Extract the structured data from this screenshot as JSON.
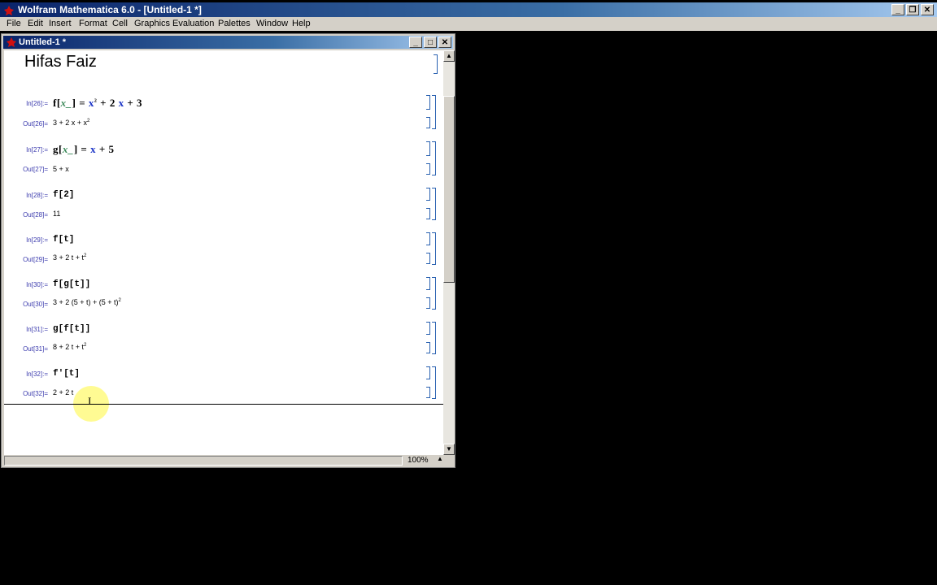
{
  "app": {
    "title": "Wolfram Mathematica 6.0 - [Untitled-1 *]",
    "menu": [
      "File",
      "Edit",
      "Insert",
      "Format",
      "Cell",
      "Graphics",
      "Evaluation",
      "Palettes",
      "Window",
      "Help"
    ]
  },
  "notebook": {
    "title": "Untitled-1 *",
    "heading": "Hifas Faiz",
    "zoom": "100%",
    "cells": [
      {
        "in_label": "In[26]:=",
        "out_label": "Out[26]=",
        "out": "3 + 2 x + x"
      },
      {
        "in_label": "In[27]:=",
        "out_label": "Out[27]=",
        "out": "5 + x"
      },
      {
        "in_label": "In[28]:=",
        "in": "f[2]",
        "out_label": "Out[28]=",
        "out": "11"
      },
      {
        "in_label": "In[29]:=",
        "in": "f[t]",
        "out_label": "Out[29]=",
        "out": "3 + 2 t + t"
      },
      {
        "in_label": "In[30]:=",
        "in": "f[g[t]]",
        "out_label": "Out[30]=",
        "out": "3 + 2 (5 + t) + (5 + t)"
      },
      {
        "in_label": "In[31]:=",
        "in": "g[f[t]]",
        "out_label": "Out[31]=",
        "out": "8 + 2 t + t"
      },
      {
        "in_label": "In[32]:=",
        "in": "f'[t]",
        "out_label": "Out[32]=",
        "out": "2 + 2 t"
      }
    ]
  }
}
